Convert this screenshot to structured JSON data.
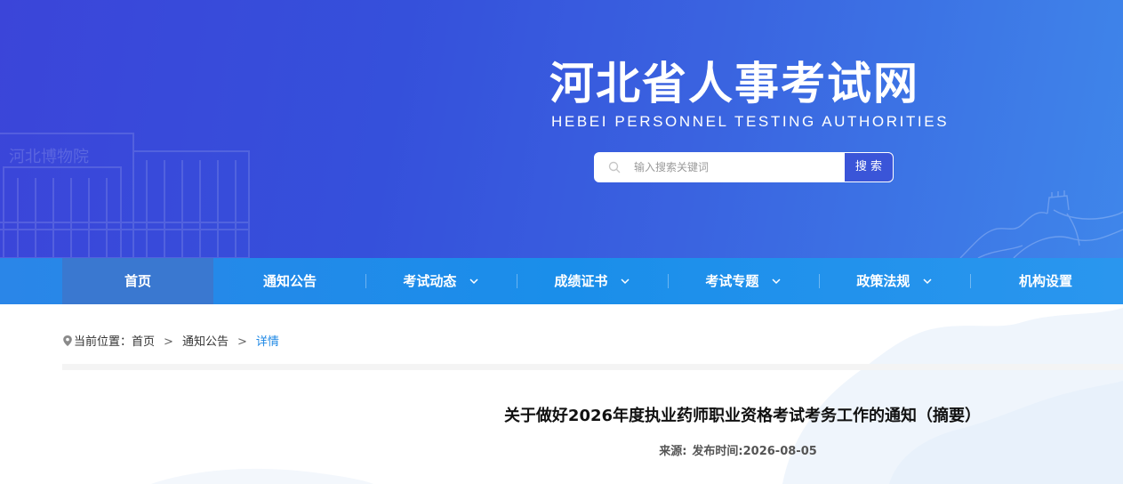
{
  "header": {
    "site_title": "河北省人事考试网",
    "site_subtitle": "HEBEI PERSONNEL TESTING AUTHORITIES",
    "watermark_text": "河北博物院"
  },
  "search": {
    "placeholder": "输入搜索关键词",
    "value": "",
    "button_label": "搜 索"
  },
  "nav": {
    "items": [
      {
        "label": "首页",
        "active": true,
        "dropdown": false
      },
      {
        "label": "通知公告",
        "active": false,
        "dropdown": false
      },
      {
        "label": "考试动态",
        "active": false,
        "dropdown": true
      },
      {
        "label": "成绩证书",
        "active": false,
        "dropdown": true
      },
      {
        "label": "考试专题",
        "active": false,
        "dropdown": true
      },
      {
        "label": "政策法规",
        "active": false,
        "dropdown": true
      },
      {
        "label": "机构设置",
        "active": false,
        "dropdown": false
      }
    ]
  },
  "breadcrumb": {
    "prefix": "当前位置：",
    "items": [
      "首页",
      "通知公告",
      "详情"
    ],
    "separator": ">"
  },
  "article": {
    "title": "关于做好2026年度执业药师职业资格考试考务工作的通知（摘要）",
    "source_label": "来源:",
    "publish_label": "发布时间:",
    "publish_date": "2026-08-05"
  },
  "colors": {
    "banner_start": "#3b45d9",
    "banner_end": "#3f86ea",
    "nav_bg": "#1a8eea",
    "nav_active": "#3a78d0",
    "search_button": "#3a55d8",
    "breadcrumb_current": "#1e88e5"
  }
}
